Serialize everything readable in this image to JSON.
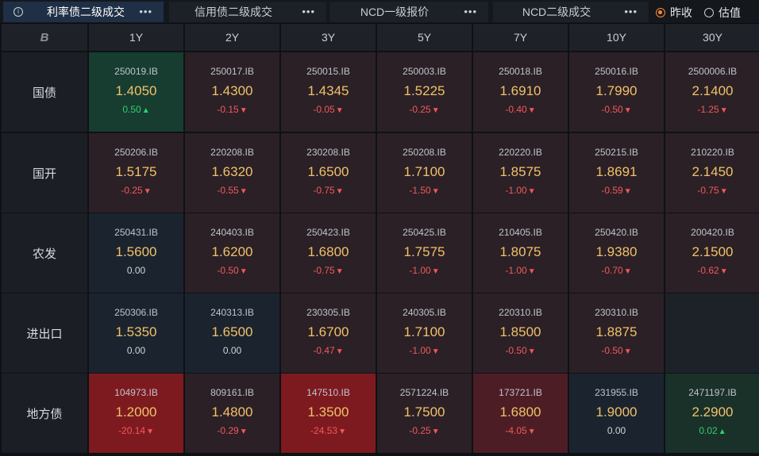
{
  "tabs": [
    {
      "label": "利率债二级成交",
      "active": true
    },
    {
      "label": "信用债二级成交",
      "active": false
    },
    {
      "label": "NCD一级报价",
      "active": false
    },
    {
      "label": "NCD二级成交",
      "active": false
    }
  ],
  "tab_menu_glyph": "•••",
  "info_glyph": "i",
  "radio_options": [
    {
      "label": "昨收",
      "checked": true
    },
    {
      "label": "估值",
      "checked": false
    }
  ],
  "colors": {
    "accent": "#ff8a2b",
    "up": "#2ecf75",
    "down": "#f2585a",
    "yield": "#f0c16a"
  },
  "corner_logo": "B",
  "columns": [
    "1Y",
    "2Y",
    "3Y",
    "5Y",
    "7Y",
    "10Y",
    "30Y"
  ],
  "rows": [
    {
      "label": "国债",
      "cells": [
        {
          "code": "250019.IB",
          "yield": "1.4050",
          "change": "0.50",
          "dir": "up",
          "tone": "c-up"
        },
        {
          "code": "250017.IB",
          "yield": "1.4300",
          "change": "-0.15",
          "dir": "down",
          "tone": "c-down"
        },
        {
          "code": "250015.IB",
          "yield": "1.4345",
          "change": "-0.05",
          "dir": "down",
          "tone": "c-down"
        },
        {
          "code": "250003.IB",
          "yield": "1.5225",
          "change": "-0.25",
          "dir": "down",
          "tone": "c-down"
        },
        {
          "code": "250018.IB",
          "yield": "1.6910",
          "change": "-0.40",
          "dir": "down",
          "tone": "c-down"
        },
        {
          "code": "250016.IB",
          "yield": "1.7990",
          "change": "-0.50",
          "dir": "down",
          "tone": "c-down"
        },
        {
          "code": "2500006.IB",
          "yield": "2.1400",
          "change": "-1.25",
          "dir": "down",
          "tone": "c-down"
        }
      ]
    },
    {
      "label": "国开",
      "cells": [
        {
          "code": "250206.IB",
          "yield": "1.5175",
          "change": "-0.25",
          "dir": "down",
          "tone": "c-down"
        },
        {
          "code": "220208.IB",
          "yield": "1.6320",
          "change": "-0.55",
          "dir": "down",
          "tone": "c-down"
        },
        {
          "code": "230208.IB",
          "yield": "1.6500",
          "change": "-0.75",
          "dir": "down",
          "tone": "c-down"
        },
        {
          "code": "250208.IB",
          "yield": "1.7100",
          "change": "-1.50",
          "dir": "down",
          "tone": "c-down"
        },
        {
          "code": "220220.IB",
          "yield": "1.8575",
          "change": "-1.00",
          "dir": "down",
          "tone": "c-down"
        },
        {
          "code": "250215.IB",
          "yield": "1.8691",
          "change": "-0.59",
          "dir": "down",
          "tone": "c-down"
        },
        {
          "code": "210220.IB",
          "yield": "2.1450",
          "change": "-0.75",
          "dir": "down",
          "tone": "c-down"
        }
      ]
    },
    {
      "label": "农发",
      "cells": [
        {
          "code": "250431.IB",
          "yield": "1.5600",
          "change": "0.00",
          "dir": "flat",
          "tone": "c-flat"
        },
        {
          "code": "240403.IB",
          "yield": "1.6200",
          "change": "-0.50",
          "dir": "down",
          "tone": "c-down"
        },
        {
          "code": "250423.IB",
          "yield": "1.6800",
          "change": "-0.75",
          "dir": "down",
          "tone": "c-down"
        },
        {
          "code": "250425.IB",
          "yield": "1.7575",
          "change": "-1.00",
          "dir": "down",
          "tone": "c-down"
        },
        {
          "code": "210405.IB",
          "yield": "1.8075",
          "change": "-1.00",
          "dir": "down",
          "tone": "c-down"
        },
        {
          "code": "250420.IB",
          "yield": "1.9380",
          "change": "-0.70",
          "dir": "down",
          "tone": "c-down"
        },
        {
          "code": "200420.IB",
          "yield": "2.1500",
          "change": "-0.62",
          "dir": "down",
          "tone": "c-down"
        }
      ]
    },
    {
      "label": "进出口",
      "cells": [
        {
          "code": "250306.IB",
          "yield": "1.5350",
          "change": "0.00",
          "dir": "flat",
          "tone": "c-flat"
        },
        {
          "code": "240313.IB",
          "yield": "1.6500",
          "change": "0.00",
          "dir": "flat",
          "tone": "c-flat"
        },
        {
          "code": "230305.IB",
          "yield": "1.6700",
          "change": "-0.47",
          "dir": "down",
          "tone": "c-down"
        },
        {
          "code": "240305.IB",
          "yield": "1.7100",
          "change": "-1.00",
          "dir": "down",
          "tone": "c-down"
        },
        {
          "code": "220310.IB",
          "yield": "1.8500",
          "change": "-0.50",
          "dir": "down",
          "tone": "c-down"
        },
        {
          "code": "230310.IB",
          "yield": "1.8875",
          "change": "-0.50",
          "dir": "down",
          "tone": "c-down"
        },
        null
      ]
    },
    {
      "label": "地方债",
      "cells": [
        {
          "code": "104973.IB",
          "yield": "1.2000",
          "change": "-20.14",
          "dir": "down",
          "tone": "c-strong-down"
        },
        {
          "code": "809161.IB",
          "yield": "1.4800",
          "change": "-0.29",
          "dir": "down",
          "tone": "c-down"
        },
        {
          "code": "147510.IB",
          "yield": "1.3500",
          "change": "-24.53",
          "dir": "down",
          "tone": "c-strong-down"
        },
        {
          "code": "2571224.IB",
          "yield": "1.7500",
          "change": "-0.25",
          "dir": "down",
          "tone": "c-down"
        },
        {
          "code": "173721.IB",
          "yield": "1.6800",
          "change": "-4.05",
          "dir": "down",
          "tone": "c-mid-down"
        },
        {
          "code": "231955.IB",
          "yield": "1.9000",
          "change": "0.00",
          "dir": "flat",
          "tone": "c-flat"
        },
        {
          "code": "2471197.IB",
          "yield": "2.2900",
          "change": "0.02",
          "dir": "up",
          "tone": "c-up-light"
        }
      ]
    }
  ]
}
